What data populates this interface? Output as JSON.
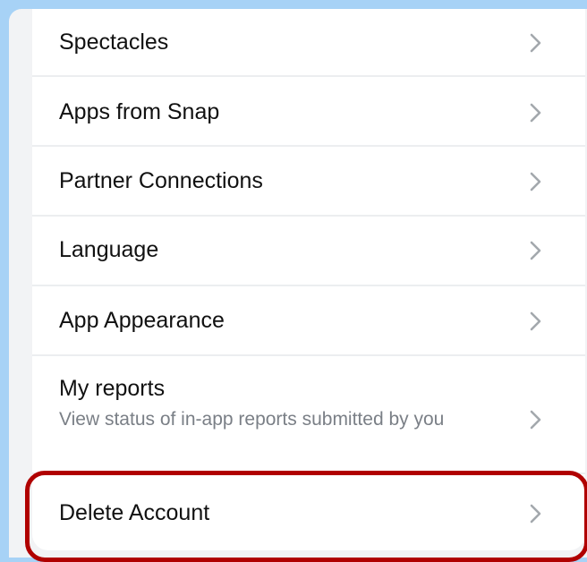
{
  "settings": {
    "items": [
      {
        "label": "Spectacles"
      },
      {
        "label": "Apps from Snap"
      },
      {
        "label": "Partner Connections"
      },
      {
        "label": "Language"
      },
      {
        "label": "App Appearance"
      },
      {
        "label": "My reports",
        "sublabel": "View status of in-app reports submitted by you"
      },
      {
        "label": "Delete Account"
      }
    ]
  },
  "colors": {
    "highlight_border": "#b00000",
    "background_frame": "#a7d2f6"
  },
  "icons": {
    "row_chevron": "chevron-right-icon"
  }
}
